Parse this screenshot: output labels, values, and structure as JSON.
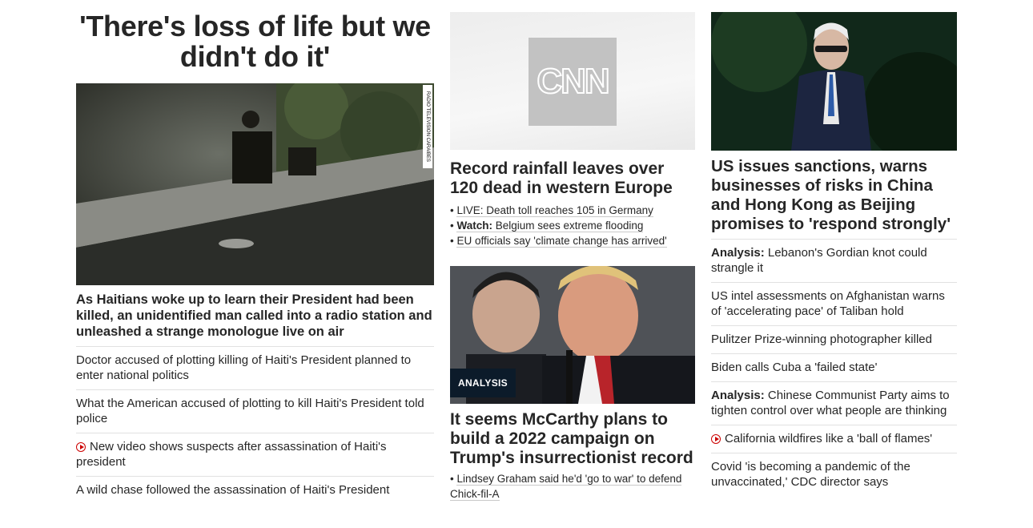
{
  "col1": {
    "headline": "'There's loss of life but we didn't do it'",
    "image_credit": "RADIO TELEVISION CARAIBES",
    "lead": "As Haitians woke up to learn their President had been killed, an unidentified man called into a radio station and unleashed a strange monologue live on air",
    "related": [
      {
        "text": "Doctor accused of plotting killing of Haiti's President planned to enter national politics"
      },
      {
        "text": "What the American accused of plotting to kill Haiti's President told police"
      },
      {
        "text": "New video shows suspects after assassination of Haiti's president"
      },
      {
        "text": "A wild chase followed the assassination of Haiti's President"
      }
    ]
  },
  "col2": {
    "cnn_logo": "CNN",
    "story1": {
      "headline": "Record rainfall leaves over 120 dead in western Europe",
      "bullets": [
        {
          "prefix": "",
          "text": "LIVE: Death toll reaches 105 in Germany"
        },
        {
          "prefix": "Watch:",
          "text": "Belgium sees extreme flooding"
        },
        {
          "prefix": "",
          "text": "EU officials say 'climate change has arrived'"
        }
      ]
    },
    "story2": {
      "tag": "ANALYSIS",
      "headline": "It seems McCarthy plans to build a 2022 campaign on Trump's insurrectionist record",
      "bullets": [
        {
          "text": "Lindsey Graham said he'd 'go to war' to defend Chick-fil-A"
        }
      ]
    }
  },
  "col3": {
    "headline": "US issues sanctions, warns businesses of risks in China and Hong Kong as Beijing promises to 'respond strongly'",
    "related": [
      {
        "prefix": "Analysis:",
        "text": "Lebanon's Gordian knot could strangle it"
      },
      {
        "prefix": "",
        "text": "US intel assessments on Afghanistan warns of 'accelerating pace' of Taliban hold"
      },
      {
        "prefix": "",
        "text": "Pulitzer Prize-winning photographer killed"
      },
      {
        "prefix": "",
        "text": "Biden calls Cuba a 'failed state'"
      },
      {
        "prefix": "Analysis:",
        "text": "Chinese Communist Party aims to tighten control over what people are thinking"
      },
      {
        "prefix": "",
        "text": "California wildfires like a 'ball of flames'"
      },
      {
        "prefix": "",
        "text": "Covid 'is becoming a pandemic of the unvaccinated,' CDC director says"
      }
    ]
  },
  "colors": {
    "accent_red": "#cc0000",
    "analysis_tag_bg": "#0c1b2a",
    "divider": "#e1e1e1"
  }
}
